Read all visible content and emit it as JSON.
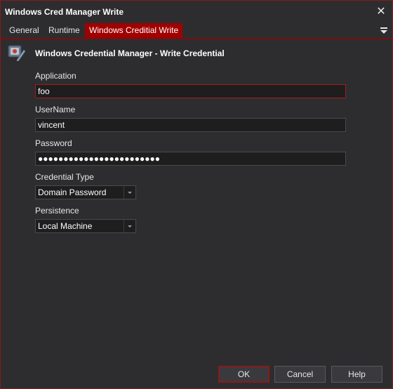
{
  "window": {
    "title": "Windows Cred Manager Write"
  },
  "tabs": [
    {
      "label": "General"
    },
    {
      "label": "Runtime"
    },
    {
      "label": "Windows Creditial Write"
    }
  ],
  "header": {
    "title": "Windows Credential Manager - Write Credential"
  },
  "form": {
    "application": {
      "label": "Application",
      "value": "foo"
    },
    "username": {
      "label": "UserName",
      "value": "vincent"
    },
    "password": {
      "label": "Password",
      "value": "●●●●●●●●●●●●●●●●●●●●●●●●"
    },
    "credential_type": {
      "label": "Credential Type",
      "value": "Domain Password"
    },
    "persistence": {
      "label": "Persistence",
      "value": "Local Machine"
    }
  },
  "buttons": {
    "ok": "OK",
    "cancel": "Cancel",
    "help": "Help"
  },
  "colors": {
    "accent": "#a00000",
    "background": "#2d2d30",
    "input_bg": "#1e1e1e"
  }
}
